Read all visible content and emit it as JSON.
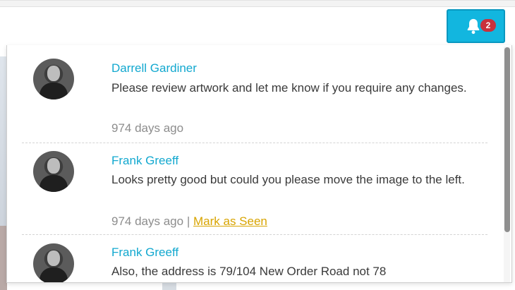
{
  "header": {
    "notifications_badge": "2",
    "bell_icon": "bell-icon",
    "accent_color": "#12b6df",
    "badge_color": "#c9303c"
  },
  "notifications": [
    {
      "author": "Darrell Gardiner",
      "message": "Please review artwork and let me know if you require any changes.",
      "time": "974 days ago"
    },
    {
      "author": "Frank Greeff",
      "message": "Looks pretty good but could you please move the image to the left.",
      "time": "974 days ago",
      "separator": "|",
      "action_label": "Mark as Seen"
    },
    {
      "author": "Frank Greeff",
      "message": "Also, the address is 79/104 New Order Road not 78"
    }
  ]
}
